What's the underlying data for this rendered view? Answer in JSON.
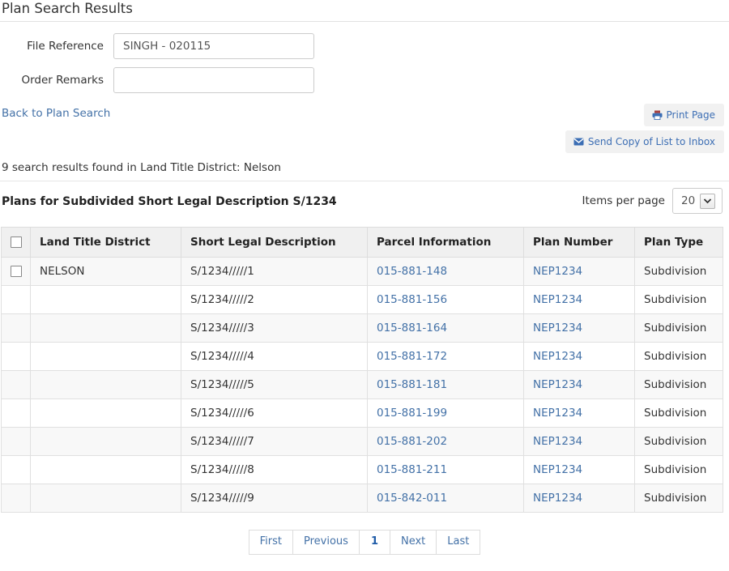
{
  "header": {
    "title": "Plan Search Results"
  },
  "form": {
    "file_reference": {
      "label": "File Reference",
      "value": "SINGH - 020115",
      "placeholder": ""
    },
    "order_remarks": {
      "label": "Order Remarks",
      "value": "",
      "placeholder": ""
    }
  },
  "actions": {
    "back_link": "Back to Plan Search",
    "print_button": "Print Page",
    "send_button": "Send Copy of List to Inbox",
    "print_icon": "printer-icon",
    "send_icon": "envelope-icon"
  },
  "results": {
    "summary": "9 search results found in Land Title District: Nelson",
    "subheading": "Plans for Subdivided Short Legal Description S/1234",
    "items_per_page_label": "Items per page",
    "items_per_page_value": "20"
  },
  "table": {
    "columns": [
      "",
      "Land Title District",
      "Short Legal Description",
      "Parcel Information",
      "Plan Number",
      "Plan Type"
    ],
    "rows": [
      {
        "land_title_district": "NELSON",
        "short_legal_description": "S/1234/////1",
        "parcel_information": "015-881-148",
        "plan_number": "NEP1234",
        "plan_type": "Subdivision"
      },
      {
        "land_title_district": "",
        "short_legal_description": "S/1234/////2",
        "parcel_information": "015-881-156",
        "plan_number": "NEP1234",
        "plan_type": "Subdivision"
      },
      {
        "land_title_district": "",
        "short_legal_description": "S/1234/////3",
        "parcel_information": "015-881-164",
        "plan_number": "NEP1234",
        "plan_type": "Subdivision"
      },
      {
        "land_title_district": "",
        "short_legal_description": "S/1234/////4",
        "parcel_information": "015-881-172",
        "plan_number": "NEP1234",
        "plan_type": "Subdivision"
      },
      {
        "land_title_district": "",
        "short_legal_description": "S/1234/////5",
        "parcel_information": "015-881-181",
        "plan_number": "NEP1234",
        "plan_type": "Subdivision"
      },
      {
        "land_title_district": "",
        "short_legal_description": "S/1234/////6",
        "parcel_information": "015-881-199",
        "plan_number": "NEP1234",
        "plan_type": "Subdivision"
      },
      {
        "land_title_district": "",
        "short_legal_description": "S/1234/////7",
        "parcel_information": "015-881-202",
        "plan_number": "NEP1234",
        "plan_type": "Subdivision"
      },
      {
        "land_title_district": "",
        "short_legal_description": "S/1234/////8",
        "parcel_information": "015-881-211",
        "plan_number": "NEP1234",
        "plan_type": "Subdivision"
      },
      {
        "land_title_district": "",
        "short_legal_description": "S/1234/////9",
        "parcel_information": "015-842-011",
        "plan_number": "NEP1234",
        "plan_type": "Subdivision"
      }
    ]
  },
  "pagination": {
    "first": "First",
    "previous": "Previous",
    "current": "1",
    "next": "Next",
    "last": "Last"
  },
  "colors": {
    "link": "#4371a7",
    "header_bg": "#f0f0f0",
    "stripe": "#f8f8f8",
    "button_bg": "#f1f1f1"
  }
}
